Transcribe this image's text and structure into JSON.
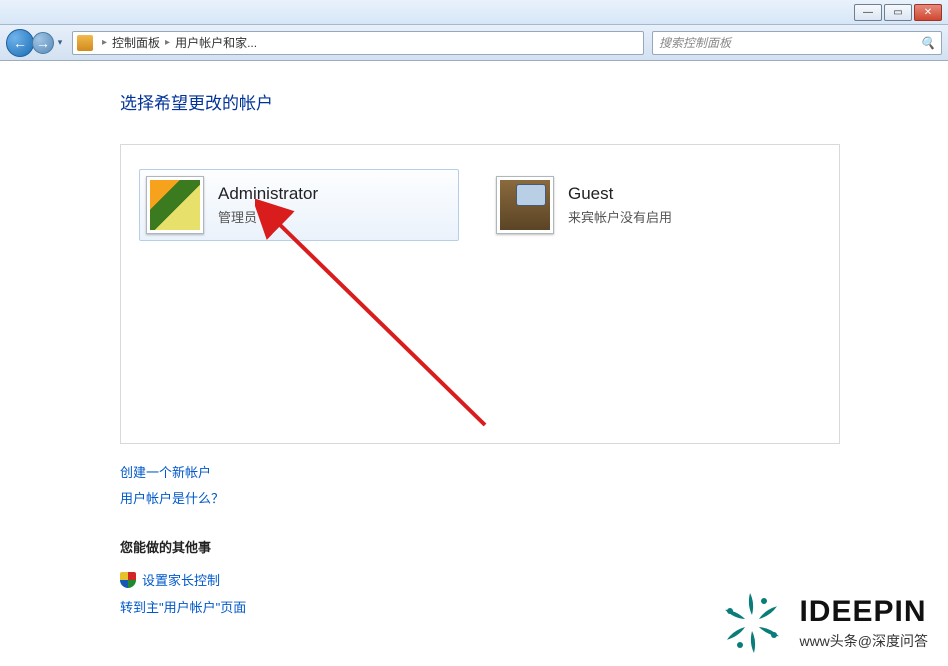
{
  "titlebar": {
    "min": "—",
    "max": "▭",
    "close": "✕"
  },
  "nav": {
    "back": "←",
    "fwd": "→",
    "drop": "▾",
    "crumb1": "控制面板",
    "crumb2": "用户帐户和家...",
    "sep": "▸"
  },
  "search": {
    "placeholder": "搜索控制面板",
    "mag": "🔍"
  },
  "page": {
    "heading": "选择希望更改的帐户",
    "accounts": [
      {
        "name": "Administrator",
        "role": "管理员"
      },
      {
        "name": "Guest",
        "role": "来宾帐户没有启用"
      }
    ],
    "link_create": "创建一个新帐户",
    "link_what": "用户帐户是什么？",
    "section_label": "您能做的其他事",
    "link_parental": "设置家长控制",
    "link_goto": "转到主\"用户帐户\"页面"
  },
  "brand": {
    "title": "IDEEPIN",
    "subtitle": "www头条@深度问答"
  }
}
